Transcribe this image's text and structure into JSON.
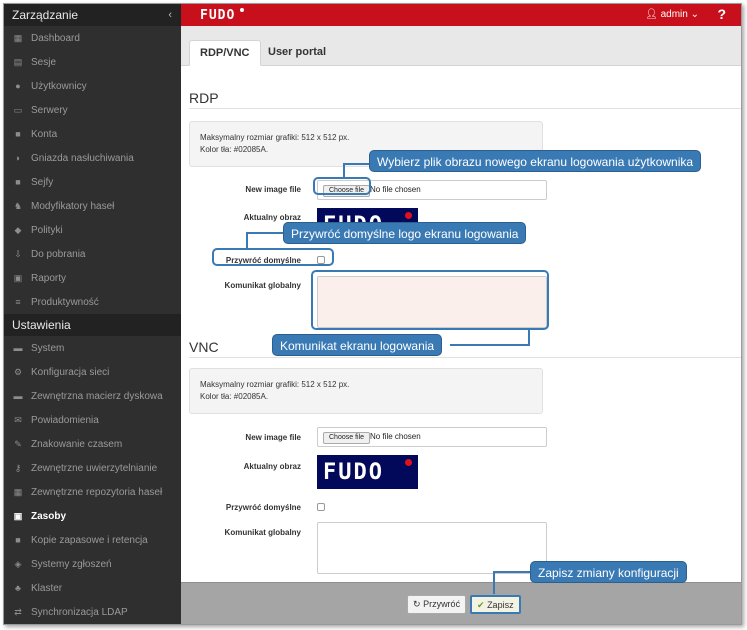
{
  "sidebar": {
    "header": "Zarządzanie",
    "collapse_icon": "chevron-left-icon",
    "items": [
      {
        "label": "Dashboard",
        "icon": "▦"
      },
      {
        "label": "Sesje",
        "icon": "▤"
      },
      {
        "label": "Użytkownicy",
        "icon": "●"
      },
      {
        "label": "Serwery",
        "icon": "▭"
      },
      {
        "label": "Konta",
        "icon": "■"
      },
      {
        "label": "Gniazda nasłuchiwania",
        "icon": "◗"
      },
      {
        "label": "Sejfy",
        "icon": "■"
      },
      {
        "label": "Modyfikatory haseł",
        "icon": "♞"
      },
      {
        "label": "Polityki",
        "icon": "◆"
      },
      {
        "label": "Do pobrania",
        "icon": "⇩"
      },
      {
        "label": "Raporty",
        "icon": "▣"
      },
      {
        "label": "Produktywność",
        "icon": "≡"
      }
    ],
    "section2": "Ustawienia",
    "items2": [
      {
        "label": "System",
        "icon": "▬"
      },
      {
        "label": "Konfiguracja sieci",
        "icon": "⚙"
      },
      {
        "label": "Zewnętrzna macierz dyskowa",
        "icon": "▬"
      },
      {
        "label": "Powiadomienia",
        "icon": "✉"
      },
      {
        "label": "Znakowanie czasem",
        "icon": "✎"
      },
      {
        "label": "Zewnętrzne uwierzytelnianie",
        "icon": "⚷"
      },
      {
        "label": "Zewnętrzne repozytoria haseł",
        "icon": "▦"
      },
      {
        "label": "Zasoby",
        "icon": "▣",
        "active": true
      },
      {
        "label": "Kopie zapasowe i retencja",
        "icon": "■"
      },
      {
        "label": "Systemy zgłoszeń",
        "icon": "◈"
      },
      {
        "label": "Klaster",
        "icon": "♣"
      },
      {
        "label": "Synchronizacja LDAP",
        "icon": "⇄"
      }
    ]
  },
  "topbar": {
    "logo": "FUDO",
    "user": "admin",
    "user_icon": "user-icon",
    "help": "?"
  },
  "tabs": [
    {
      "label": "RDP/VNC",
      "active": true
    },
    {
      "label": "User portal",
      "active": false
    }
  ],
  "rdp": {
    "title": "RDP",
    "info_line1": "Maksymalny rozmiar grafiki: 512 x 512 px.",
    "info_line2": "Kolor tła: #02085A.",
    "new_image_label": "New image file",
    "choose_file": "Choose file",
    "no_file": "No file chosen",
    "current_image_label": "Aktualny obraz",
    "restore_default_label": "Przywróć domyślne",
    "global_message_label": "Komunikat globalny"
  },
  "vnc": {
    "title": "VNC",
    "info_line1": "Maksymalny rozmiar grafiki: 512 x 512 px.",
    "info_line2": "Kolor tła: #02085A.",
    "new_image_label": "New image file",
    "choose_file": "Choose file",
    "no_file": "No file chosen",
    "current_image_label": "Aktualny obraz",
    "restore_default_label": "Przywróć domyślne",
    "global_message_label": "Komunikat globalny"
  },
  "footer": {
    "restore_label": "Przywróć",
    "save_label": "Zapisz"
  },
  "callouts": {
    "file": "Wybierz plik obrazu nowego ekranu logowania użytkownika",
    "restore": "Przywróć domyślne logo ekranu logowania",
    "message": "Komunikat ekranu logowania",
    "save": "Zapisz zmiany konfiguracji"
  },
  "colors": {
    "brand_red": "#c8101c",
    "sidebar": "#2f2f2f",
    "callout": "#3a7ab4",
    "logo_bg": "#02085A"
  }
}
